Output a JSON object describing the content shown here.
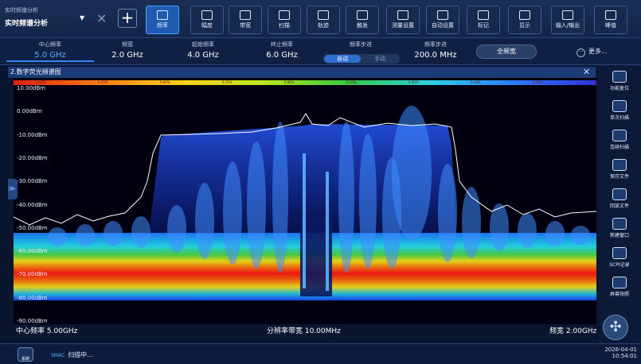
{
  "mode": {
    "subtitle": "实时频谱分析",
    "title": "实时频谱分析",
    "dropdown_icon": "▼",
    "close_icon": "×",
    "add_icon": "+"
  },
  "toolbar": [
    {
      "label": "频率",
      "icon": "frequency-icon",
      "active": true
    },
    {
      "label": "幅度",
      "icon": "amplitude-icon"
    },
    {
      "label": "带宽",
      "icon": "bandwidth-icon"
    },
    {
      "label": "扫描",
      "icon": "sweep-icon"
    },
    {
      "label": "轨迹",
      "icon": "trace-icon"
    },
    {
      "label": "触发",
      "icon": "trigger-icon"
    },
    {
      "label": "测量设置",
      "icon": "measure-setup-icon"
    },
    {
      "label": "自动设置",
      "icon": "auto-setup-icon"
    },
    {
      "label": "标记",
      "icon": "marker-icon"
    },
    {
      "label": "显示",
      "icon": "display-icon"
    },
    {
      "label": "输入/输出",
      "icon": "input-output-icon"
    },
    {
      "label": "峰值",
      "icon": "peak-icon"
    }
  ],
  "params": {
    "center": {
      "label": "中心频率",
      "value": "5.0 GHz"
    },
    "span": {
      "label": "频宽",
      "value": "2.0 GHz"
    },
    "start": {
      "label": "起始频率",
      "value": "4.0 GHz"
    },
    "stop": {
      "label": "终止频率",
      "value": "6.0 GHz"
    },
    "step": {
      "label": "频率步进",
      "auto": "自动",
      "manual": "手动"
    },
    "step_value": {
      "label": "频率步进",
      "value": "200.0 MHz"
    },
    "full_span": "全频宽",
    "more": "更多..."
  },
  "window": {
    "title": "2.数字荧光频谱图",
    "close": "✕",
    "side_tab": "≫"
  },
  "persistence_scale": [
    "1.00%",
    "0.95%",
    "0.80%",
    "0.70%",
    "0.60%",
    "0.50%",
    "0.40%",
    "0.30%",
    "0.20%",
    "0.10%"
  ],
  "y_axis": [
    "10.00dBm",
    "0.00dBm",
    "-10.00dBm",
    "-20.00dBm",
    "-30.00dBm",
    "-40.00dBm",
    "-50.00dBm",
    "-60.00dBm",
    "-70.00dBm",
    "-80.00dBm",
    "-90.00dBm"
  ],
  "footer": {
    "center_freq": "中心频率 5.00GHz",
    "rbw": "分辨率带宽 10.00MHz",
    "span": "频宽 2.00GHz"
  },
  "right_panel": [
    {
      "label": "功能复位",
      "icon": "reset-icon"
    },
    {
      "label": "单次扫描",
      "icon": "single-sweep-icon"
    },
    {
      "label": "连续扫描",
      "icon": "continuous-sweep-icon"
    },
    {
      "label": "保存文件",
      "icon": "save-icon"
    },
    {
      "label": "回放文件",
      "icon": "folder-icon"
    },
    {
      "label": "新建窗口",
      "icon": "new-window-icon"
    },
    {
      "label": "SCPI记录",
      "icon": "scpi-icon"
    },
    {
      "label": "屏幕快照",
      "icon": "screenshot-icon"
    }
  ],
  "status": {
    "system": "系统",
    "brand": "SMAC",
    "scan": "扫描中...",
    "date": "2026-04-01",
    "time": "10:54:01"
  }
}
